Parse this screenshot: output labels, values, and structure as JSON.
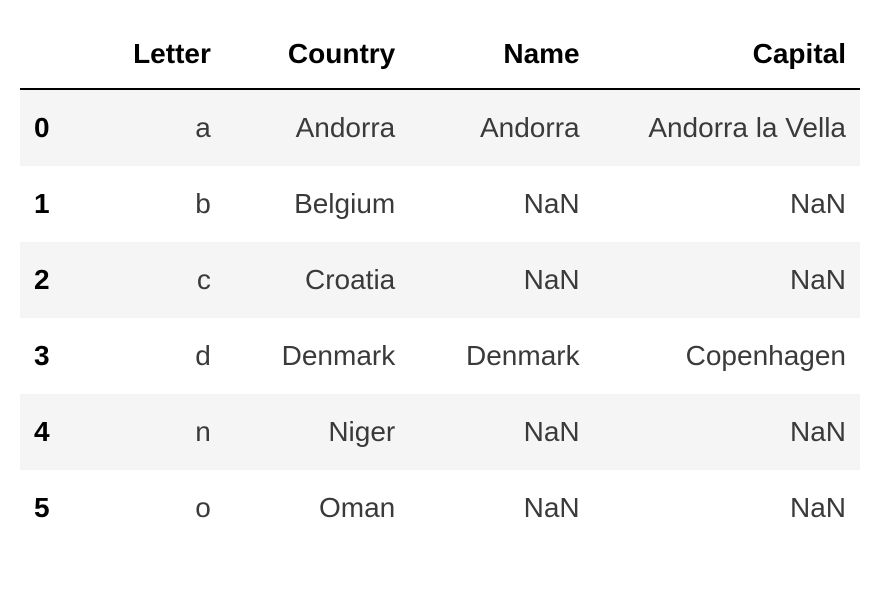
{
  "chart_data": {
    "type": "table",
    "columns": [
      "Letter",
      "Country",
      "Name",
      "Capital"
    ],
    "index": [
      "0",
      "1",
      "2",
      "3",
      "4",
      "5"
    ],
    "rows": [
      {
        "Letter": "a",
        "Country": "Andorra",
        "Name": "Andorra",
        "Capital": "Andorra la Vella"
      },
      {
        "Letter": "b",
        "Country": "Belgium",
        "Name": "NaN",
        "Capital": "NaN"
      },
      {
        "Letter": "c",
        "Country": "Croatia",
        "Name": "NaN",
        "Capital": "NaN"
      },
      {
        "Letter": "d",
        "Country": "Denmark",
        "Name": "Denmark",
        "Capital": "Copenhagen"
      },
      {
        "Letter": "n",
        "Country": "Niger",
        "Name": "NaN",
        "Capital": "NaN"
      },
      {
        "Letter": "o",
        "Country": "Oman",
        "Name": "NaN",
        "Capital": "NaN"
      }
    ]
  }
}
